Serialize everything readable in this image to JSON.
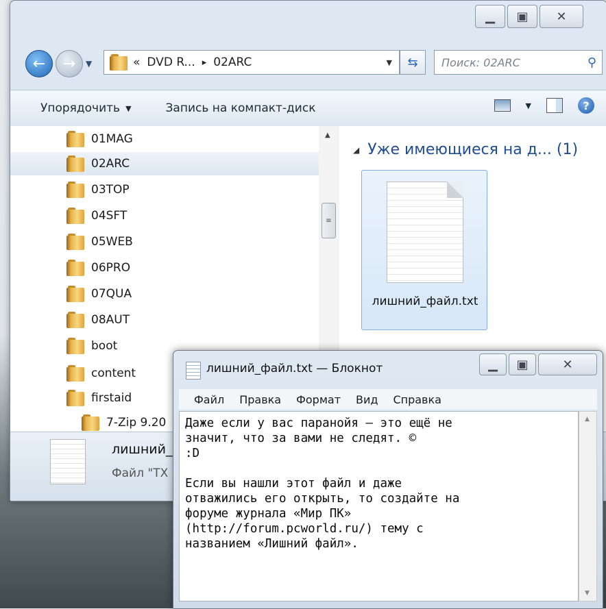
{
  "explorer": {
    "address": {
      "history_glyph": "«",
      "segment1": "DVD R...",
      "separator": "▸",
      "segment2": "02ARC"
    },
    "search_placeholder": "Поиск: 02ARC",
    "toolbar": {
      "organize": "Упорядочить",
      "burn": "Запись на компакт-диск"
    },
    "tree": [
      {
        "label": "01MAG"
      },
      {
        "label": "02ARC"
      },
      {
        "label": "03TOP"
      },
      {
        "label": "04SFT"
      },
      {
        "label": "05WEB"
      },
      {
        "label": "06PRO"
      },
      {
        "label": "07QUA"
      },
      {
        "label": "08AUT"
      },
      {
        "label": "boot"
      },
      {
        "label": "content"
      },
      {
        "label": "firstaid"
      },
      {
        "label": "7-Zip 9.20"
      }
    ],
    "group_header": "Уже имеющиеся на д... (1)",
    "file_tile_label": "лишний_файл.txt",
    "details": {
      "name": "лишний_",
      "type": "Файл \"TX"
    }
  },
  "notepad": {
    "title": "лишний_файл.txt — Блокнот",
    "menu": [
      "Файл",
      "Правка",
      "Формат",
      "Вид",
      "Справка"
    ],
    "text": "Даже если у вас паранойя – это ещё не\nзначит, что за вами не следят. ©\n:D\n\nЕсли вы нашли этот файл и даже\nотважились его открыть, то создайте на\nфоруме журнала «Мир ПК»\n(http://forum.pcworld.ru/) тему с\nназванием «Лишний файл»."
  },
  "icons": [
    "back-icon",
    "forward-icon",
    "folder-icon",
    "refresh-icon",
    "search-icon",
    "view-icon",
    "preview-pane-icon",
    "help-icon",
    "text-file-icon",
    "minimize-icon",
    "maximize-icon",
    "close-icon"
  ]
}
